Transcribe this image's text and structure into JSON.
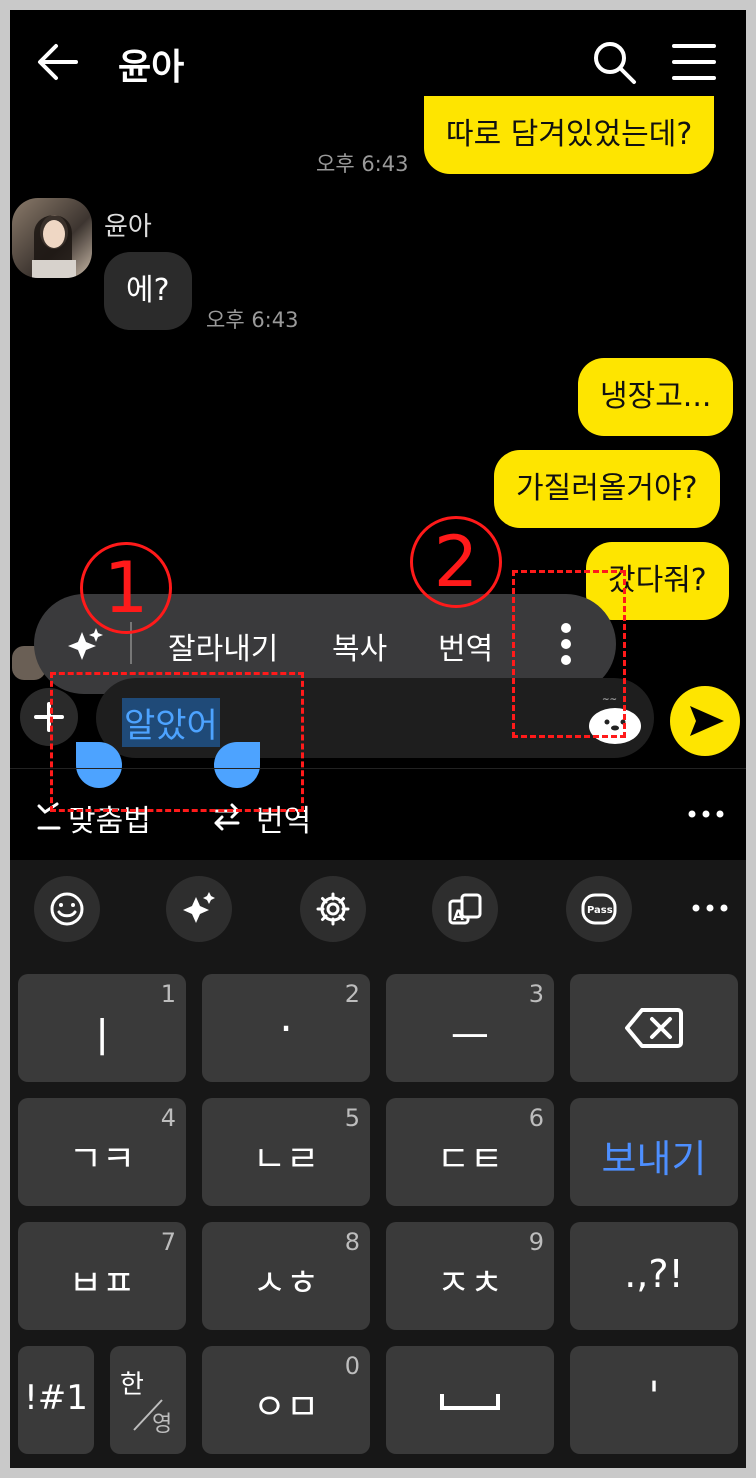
{
  "header": {
    "title": "윤아"
  },
  "messages": {
    "m1": {
      "text": "따로 담겨있었는데?",
      "time": "오후 6:43"
    },
    "m2": {
      "sender": "윤아",
      "text": "에?",
      "time": "오후 6:43"
    },
    "m3": {
      "text": "냉장고..."
    },
    "m4": {
      "text": "가질러올거야?"
    },
    "m5": {
      "text": "갔다줘?"
    }
  },
  "context_menu": {
    "cut": "잘라내기",
    "copy": "복사",
    "translate": "번역"
  },
  "input": {
    "value": "알았어"
  },
  "suggest_bar": {
    "spellcheck": "맞춤법",
    "translate": "번역"
  },
  "keyboard": {
    "r1": [
      {
        "label": "ㅣ",
        "num": "1"
      },
      {
        "label": "·",
        "num": "2"
      },
      {
        "label": "ㅡ",
        "num": "3"
      }
    ],
    "r2": [
      {
        "label": "ㄱㅋ",
        "num": "4"
      },
      {
        "label": "ㄴㄹ",
        "num": "5"
      },
      {
        "label": "ㄷㅌ",
        "num": "6"
      }
    ],
    "r3": [
      {
        "label": "ㅂㅍ",
        "num": "7"
      },
      {
        "label": "ㅅㅎ",
        "num": "8"
      },
      {
        "label": "ㅈㅊ",
        "num": "9"
      }
    ],
    "send": "보내기",
    "punct": ".,?!",
    "symbols": "!#1",
    "lang_top": "한",
    "lang_bottom": "영",
    "om": {
      "label": "ㅇㅁ",
      "num": "0"
    },
    "apostrophe": "'"
  },
  "annotations": {
    "one": "1",
    "two": "2"
  },
  "colors": {
    "accent_yellow": "#fee500",
    "selection_blue": "#4da3ff",
    "annotation_red": "#ff1a1a"
  }
}
